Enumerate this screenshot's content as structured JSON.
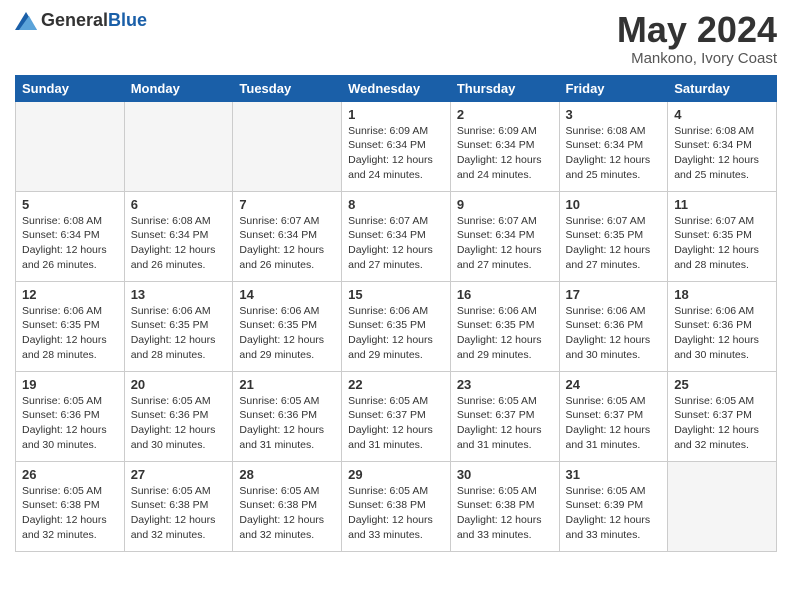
{
  "header": {
    "logo_general": "General",
    "logo_blue": "Blue",
    "main_title": "May 2024",
    "subtitle": "Mankono, Ivory Coast"
  },
  "days_of_week": [
    "Sunday",
    "Monday",
    "Tuesday",
    "Wednesday",
    "Thursday",
    "Friday",
    "Saturday"
  ],
  "weeks": [
    [
      {
        "day": "",
        "sunrise": "",
        "sunset": "",
        "daylight": "",
        "empty": true
      },
      {
        "day": "",
        "sunrise": "",
        "sunset": "",
        "daylight": "",
        "empty": true
      },
      {
        "day": "",
        "sunrise": "",
        "sunset": "",
        "daylight": "",
        "empty": true
      },
      {
        "day": "1",
        "sunrise": "Sunrise: 6:09 AM",
        "sunset": "Sunset: 6:34 PM",
        "daylight": "Daylight: 12 hours and 24 minutes."
      },
      {
        "day": "2",
        "sunrise": "Sunrise: 6:09 AM",
        "sunset": "Sunset: 6:34 PM",
        "daylight": "Daylight: 12 hours and 24 minutes."
      },
      {
        "day": "3",
        "sunrise": "Sunrise: 6:08 AM",
        "sunset": "Sunset: 6:34 PM",
        "daylight": "Daylight: 12 hours and 25 minutes."
      },
      {
        "day": "4",
        "sunrise": "Sunrise: 6:08 AM",
        "sunset": "Sunset: 6:34 PM",
        "daylight": "Daylight: 12 hours and 25 minutes."
      }
    ],
    [
      {
        "day": "5",
        "sunrise": "Sunrise: 6:08 AM",
        "sunset": "Sunset: 6:34 PM",
        "daylight": "Daylight: 12 hours and 26 minutes."
      },
      {
        "day": "6",
        "sunrise": "Sunrise: 6:08 AM",
        "sunset": "Sunset: 6:34 PM",
        "daylight": "Daylight: 12 hours and 26 minutes."
      },
      {
        "day": "7",
        "sunrise": "Sunrise: 6:07 AM",
        "sunset": "Sunset: 6:34 PM",
        "daylight": "Daylight: 12 hours and 26 minutes."
      },
      {
        "day": "8",
        "sunrise": "Sunrise: 6:07 AM",
        "sunset": "Sunset: 6:34 PM",
        "daylight": "Daylight: 12 hours and 27 minutes."
      },
      {
        "day": "9",
        "sunrise": "Sunrise: 6:07 AM",
        "sunset": "Sunset: 6:34 PM",
        "daylight": "Daylight: 12 hours and 27 minutes."
      },
      {
        "day": "10",
        "sunrise": "Sunrise: 6:07 AM",
        "sunset": "Sunset: 6:35 PM",
        "daylight": "Daylight: 12 hours and 27 minutes."
      },
      {
        "day": "11",
        "sunrise": "Sunrise: 6:07 AM",
        "sunset": "Sunset: 6:35 PM",
        "daylight": "Daylight: 12 hours and 28 minutes."
      }
    ],
    [
      {
        "day": "12",
        "sunrise": "Sunrise: 6:06 AM",
        "sunset": "Sunset: 6:35 PM",
        "daylight": "Daylight: 12 hours and 28 minutes."
      },
      {
        "day": "13",
        "sunrise": "Sunrise: 6:06 AM",
        "sunset": "Sunset: 6:35 PM",
        "daylight": "Daylight: 12 hours and 28 minutes."
      },
      {
        "day": "14",
        "sunrise": "Sunrise: 6:06 AM",
        "sunset": "Sunset: 6:35 PM",
        "daylight": "Daylight: 12 hours and 29 minutes."
      },
      {
        "day": "15",
        "sunrise": "Sunrise: 6:06 AM",
        "sunset": "Sunset: 6:35 PM",
        "daylight": "Daylight: 12 hours and 29 minutes."
      },
      {
        "day": "16",
        "sunrise": "Sunrise: 6:06 AM",
        "sunset": "Sunset: 6:35 PM",
        "daylight": "Daylight: 12 hours and 29 minutes."
      },
      {
        "day": "17",
        "sunrise": "Sunrise: 6:06 AM",
        "sunset": "Sunset: 6:36 PM",
        "daylight": "Daylight: 12 hours and 30 minutes."
      },
      {
        "day": "18",
        "sunrise": "Sunrise: 6:06 AM",
        "sunset": "Sunset: 6:36 PM",
        "daylight": "Daylight: 12 hours and 30 minutes."
      }
    ],
    [
      {
        "day": "19",
        "sunrise": "Sunrise: 6:05 AM",
        "sunset": "Sunset: 6:36 PM",
        "daylight": "Daylight: 12 hours and 30 minutes."
      },
      {
        "day": "20",
        "sunrise": "Sunrise: 6:05 AM",
        "sunset": "Sunset: 6:36 PM",
        "daylight": "Daylight: 12 hours and 30 minutes."
      },
      {
        "day": "21",
        "sunrise": "Sunrise: 6:05 AM",
        "sunset": "Sunset: 6:36 PM",
        "daylight": "Daylight: 12 hours and 31 minutes."
      },
      {
        "day": "22",
        "sunrise": "Sunrise: 6:05 AM",
        "sunset": "Sunset: 6:37 PM",
        "daylight": "Daylight: 12 hours and 31 minutes."
      },
      {
        "day": "23",
        "sunrise": "Sunrise: 6:05 AM",
        "sunset": "Sunset: 6:37 PM",
        "daylight": "Daylight: 12 hours and 31 minutes."
      },
      {
        "day": "24",
        "sunrise": "Sunrise: 6:05 AM",
        "sunset": "Sunset: 6:37 PM",
        "daylight": "Daylight: 12 hours and 31 minutes."
      },
      {
        "day": "25",
        "sunrise": "Sunrise: 6:05 AM",
        "sunset": "Sunset: 6:37 PM",
        "daylight": "Daylight: 12 hours and 32 minutes."
      }
    ],
    [
      {
        "day": "26",
        "sunrise": "Sunrise: 6:05 AM",
        "sunset": "Sunset: 6:38 PM",
        "daylight": "Daylight: 12 hours and 32 minutes."
      },
      {
        "day": "27",
        "sunrise": "Sunrise: 6:05 AM",
        "sunset": "Sunset: 6:38 PM",
        "daylight": "Daylight: 12 hours and 32 minutes."
      },
      {
        "day": "28",
        "sunrise": "Sunrise: 6:05 AM",
        "sunset": "Sunset: 6:38 PM",
        "daylight": "Daylight: 12 hours and 32 minutes."
      },
      {
        "day": "29",
        "sunrise": "Sunrise: 6:05 AM",
        "sunset": "Sunset: 6:38 PM",
        "daylight": "Daylight: 12 hours and 33 minutes."
      },
      {
        "day": "30",
        "sunrise": "Sunrise: 6:05 AM",
        "sunset": "Sunset: 6:38 PM",
        "daylight": "Daylight: 12 hours and 33 minutes."
      },
      {
        "day": "31",
        "sunrise": "Sunrise: 6:05 AM",
        "sunset": "Sunset: 6:39 PM",
        "daylight": "Daylight: 12 hours and 33 minutes."
      },
      {
        "day": "",
        "sunrise": "",
        "sunset": "",
        "daylight": "",
        "empty": true
      }
    ]
  ]
}
